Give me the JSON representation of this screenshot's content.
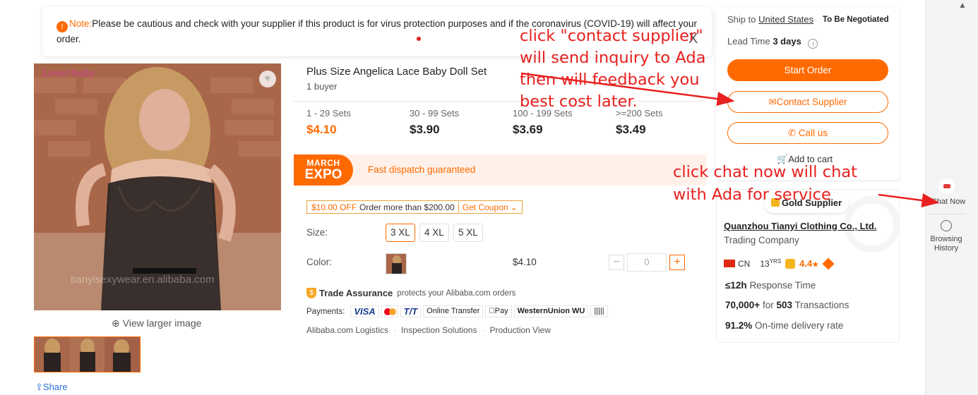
{
  "notice": {
    "label": "Note:",
    "text": "Please be cautious and check with your supplier if this product is for virus protection purposes and if the coronavirus (COVID-19) will affect your order.",
    "close": "X"
  },
  "gallery": {
    "brand": "Lover-baby",
    "watermark": "tianyisexywear.en.alibaba.com",
    "view_larger": "View larger image",
    "share": "Share"
  },
  "product": {
    "title": "Plus Size Angelica Lace Baby Doll Set",
    "buyers": "1 buyer",
    "tiers": [
      {
        "range": "1 - 29 Sets",
        "price": "$4.10"
      },
      {
        "range": "30 - 99 Sets",
        "price": "$3.90"
      },
      {
        "range": "100 - 199 Sets",
        "price": "$3.69"
      },
      {
        "range": ">=200 Sets",
        "price": "$3.49"
      }
    ],
    "expo": {
      "line1": "MARCH",
      "line2": "EXPO",
      "text": "Fast dispatch guaranteed"
    },
    "coupon": {
      "off": "$10.00 OFF",
      "condition": "Order more than $200.00",
      "get": "Get Coupon"
    },
    "size_label": "Size:",
    "sizes": [
      "3 XL",
      "4 XL",
      "5 XL"
    ],
    "color_label": "Color:",
    "unit_price": "$4.10",
    "quantity": "0",
    "trade_assurance": {
      "name": "Trade Assurance",
      "desc": "protects your Alibaba.com orders"
    },
    "payments_label": "Payments:",
    "payments": [
      "VISA",
      "T/T",
      "Online Transfer",
      "Pay",
      "WesternUnion WU"
    ],
    "links": [
      "Alibaba.com Logistics",
      "Inspection Solutions",
      "Production View"
    ]
  },
  "order": {
    "ship_to": "Ship to",
    "country": "United States",
    "shipping": "To Be Negotiated",
    "lead_label": "Lead Time",
    "lead_value": "3 days",
    "start": "Start Order",
    "contact": "Contact Supplier",
    "call": "Call us",
    "cart": "Add to cart"
  },
  "supplier": {
    "badge": "Gold Supplier",
    "name": "Quanzhou Tianyi Clothing Co., Ltd.",
    "type": "Trading Company",
    "country": "CN",
    "years": "13",
    "years_unit": "YRS",
    "rating": "4.4",
    "response_value": "≤12h",
    "response_label": "Response Time",
    "txn_amount": "70,000+",
    "txn_for": "for",
    "txn_count": "503",
    "txn_label": "Transactions",
    "ontime_value": "91.2%",
    "ontime_label": "On-time delivery rate"
  },
  "sidebar": {
    "chat": "Chat Now",
    "history": "Browsing History"
  },
  "annotations": {
    "a1": "click \"contact supplier\" will send inquiry to Ada then will feedback you best cost later.",
    "a2": "click chat now will chat with Ada for service"
  },
  "colors": {
    "accent": "#ff6a00",
    "annotation": "#e8201f"
  }
}
